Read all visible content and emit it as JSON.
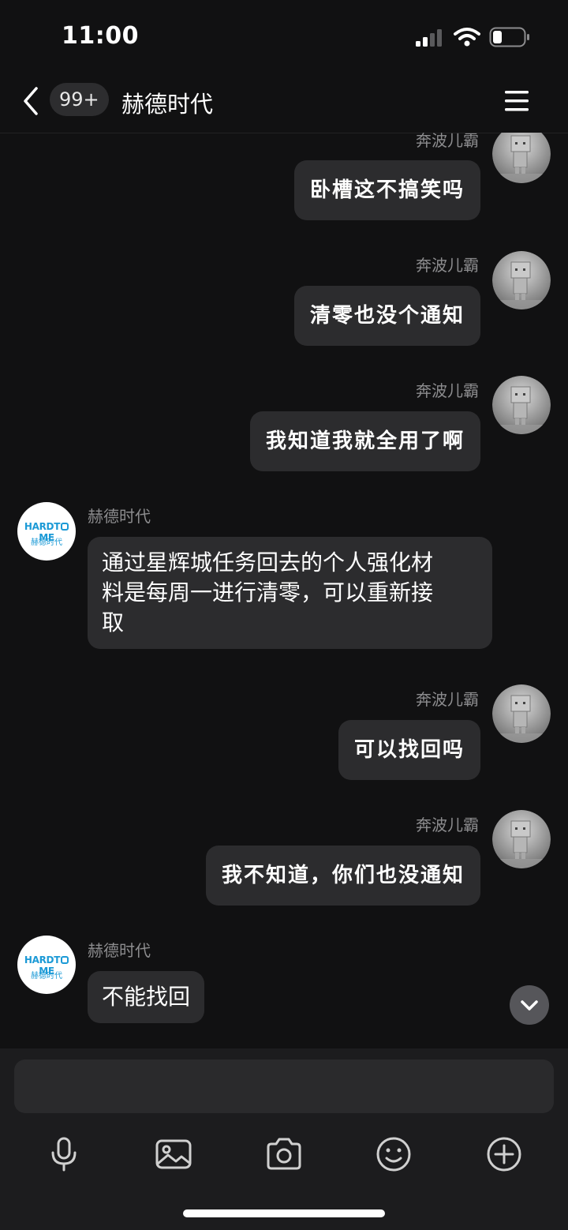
{
  "status_bar": {
    "time": "11:00"
  },
  "header": {
    "unread_badge": "99+",
    "title": "赫德时代"
  },
  "messages": [
    {
      "sender": "奔波儿霸",
      "text": "卧槽这不搞笑吗"
    },
    {
      "sender": "奔波儿霸",
      "text": "清零也没个通知"
    },
    {
      "sender": "奔波儿霸",
      "text": "我知道我就全用了啊"
    },
    {
      "sender": "赫德时代",
      "lines": [
        "通过星辉城任务回去的个人强化材",
        "料是每周一进行清零，可以重新接",
        "取"
      ]
    },
    {
      "sender": "奔波儿霸",
      "text": "可以找回吗"
    },
    {
      "sender": "奔波儿霸",
      "text": "我不知道，你们也没通知"
    },
    {
      "sender": "赫德时代",
      "lines": [
        "不能找回"
      ]
    }
  ],
  "logo": {
    "brand": "HARDTIME",
    "brand_left": "HARDT",
    "brand_right": "ME",
    "subtitle": "赫德时代"
  },
  "input": {
    "placeholder": ""
  },
  "toolbar": [
    "mic-icon",
    "image-icon",
    "camera-icon",
    "emoji-icon",
    "plus-icon"
  ],
  "colors": {
    "background": "#111112",
    "bubble": "#2c2c2e",
    "name_text": "#8c8c8e",
    "logo_blue": "#1c9ad6",
    "input_bar": "#1c1c1e"
  }
}
